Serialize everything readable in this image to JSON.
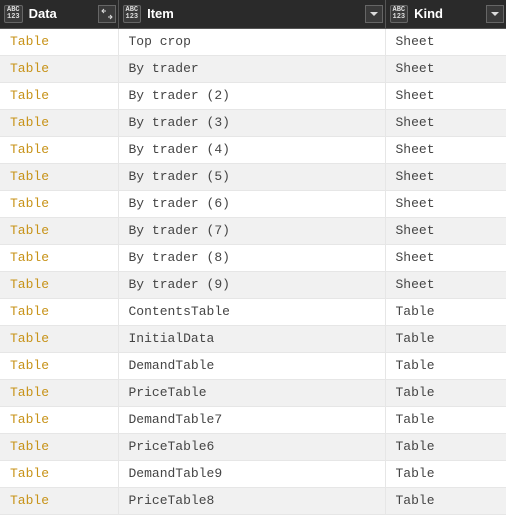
{
  "type_icon": {
    "top": "ABC",
    "bot": "123"
  },
  "columns": [
    {
      "key": "data",
      "label": "Data",
      "action_icon": "expand"
    },
    {
      "key": "item",
      "label": "Item",
      "action_icon": "dropdown"
    },
    {
      "key": "kind",
      "label": "Kind",
      "action_icon": "dropdown"
    }
  ],
  "rows": [
    {
      "data": "Table",
      "item": "Top crop",
      "kind": "Sheet"
    },
    {
      "data": "Table",
      "item": "By trader",
      "kind": "Sheet"
    },
    {
      "data": "Table",
      "item": "By trader (2)",
      "kind": "Sheet"
    },
    {
      "data": "Table",
      "item": "By trader (3)",
      "kind": "Sheet"
    },
    {
      "data": "Table",
      "item": "By trader (4)",
      "kind": "Sheet"
    },
    {
      "data": "Table",
      "item": "By trader (5)",
      "kind": "Sheet"
    },
    {
      "data": "Table",
      "item": "By trader (6)",
      "kind": "Sheet"
    },
    {
      "data": "Table",
      "item": "By trader (7)",
      "kind": "Sheet"
    },
    {
      "data": "Table",
      "item": "By trader (8)",
      "kind": "Sheet"
    },
    {
      "data": "Table",
      "item": "By trader (9)",
      "kind": "Sheet"
    },
    {
      "data": "Table",
      "item": "ContentsTable",
      "kind": "Table"
    },
    {
      "data": "Table",
      "item": "InitialData",
      "kind": "Table"
    },
    {
      "data": "Table",
      "item": "DemandTable",
      "kind": "Table"
    },
    {
      "data": "Table",
      "item": "PriceTable",
      "kind": "Table"
    },
    {
      "data": "Table",
      "item": "DemandTable7",
      "kind": "Table"
    },
    {
      "data": "Table",
      "item": "PriceTable6",
      "kind": "Table"
    },
    {
      "data": "Table",
      "item": "DemandTable9",
      "kind": "Table"
    },
    {
      "data": "Table",
      "item": "PriceTable8",
      "kind": "Table"
    }
  ]
}
